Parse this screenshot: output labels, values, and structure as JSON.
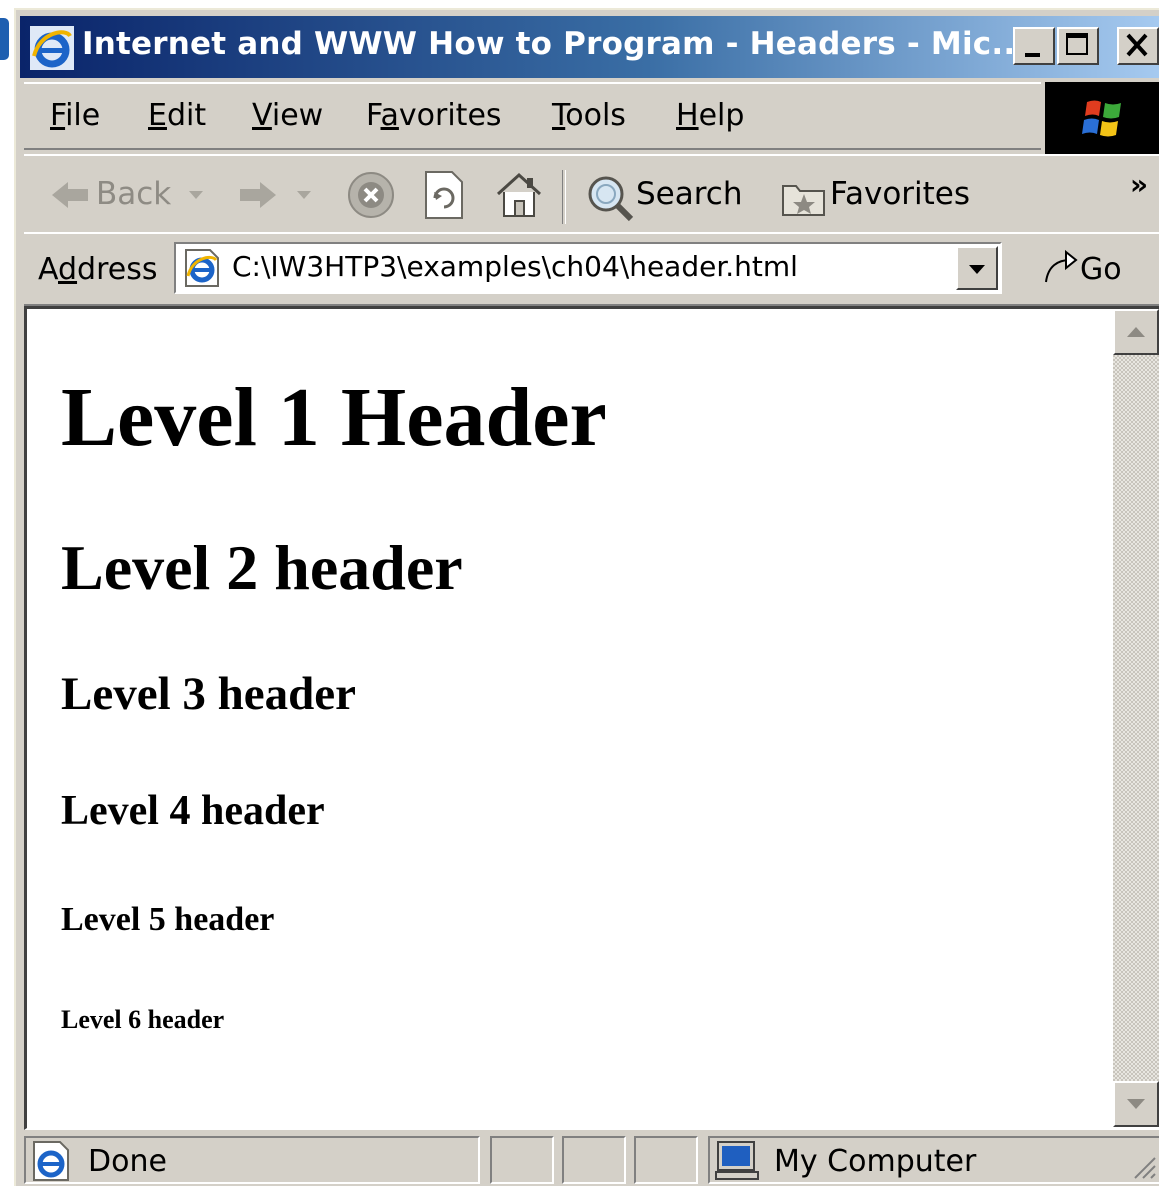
{
  "window": {
    "title": "Internet and WWW How to Program - Headers - Mic..."
  },
  "menu": {
    "items": [
      {
        "label": "File",
        "accel": "F"
      },
      {
        "label": "Edit",
        "accel": "E"
      },
      {
        "label": "View",
        "accel": "V"
      },
      {
        "label": "Favorites",
        "accel": "a"
      },
      {
        "label": "Tools",
        "accel": "T"
      },
      {
        "label": "Help",
        "accel": "H"
      }
    ]
  },
  "toolbar": {
    "back_label": "Back",
    "search_label": "Search",
    "favorites_label": "Favorites",
    "chevron": "»"
  },
  "address": {
    "label": "Address",
    "value": "C:\\IW3HTP3\\examples\\ch04\\header.html",
    "go_label": "Go"
  },
  "page": {
    "h1": "Level 1 Header",
    "h2": "Level 2 header",
    "h3": "Level 3 header",
    "h4": "Level 4 header",
    "h5": "Level 5 header",
    "h6": "Level 6 header"
  },
  "status": {
    "text": "Done",
    "zone": "My Computer"
  },
  "colors": {
    "titlebar_start": "#0a246a",
    "titlebar_end": "#a6caf0",
    "chrome": "#d4d0c8"
  }
}
